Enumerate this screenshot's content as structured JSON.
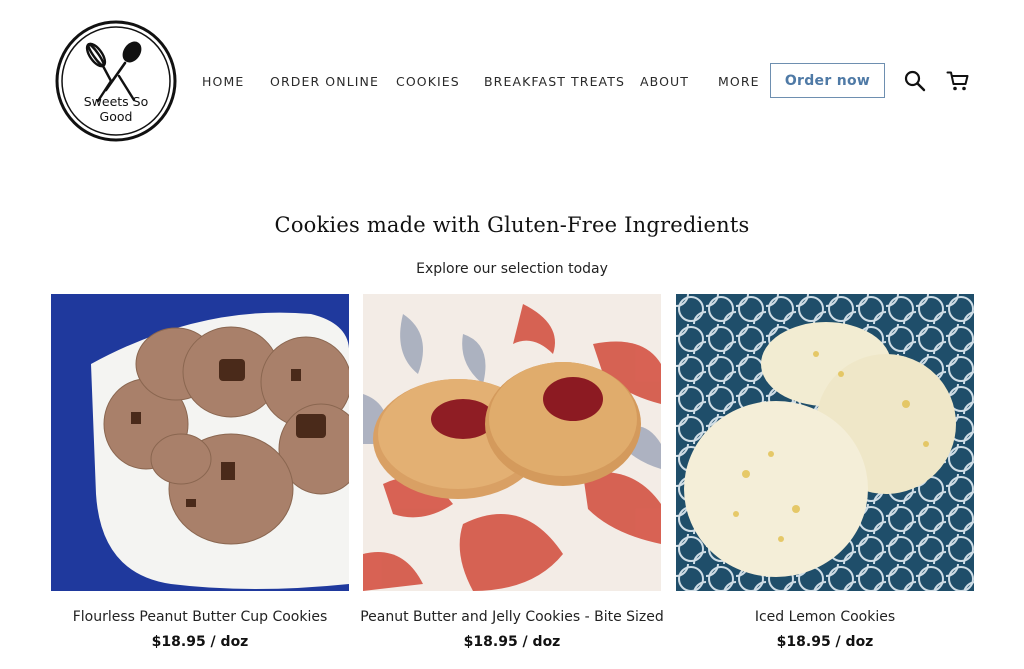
{
  "header": {
    "logo_text_line1": "Sweets So",
    "logo_text_line2": "Good",
    "nav": [
      "HOME",
      "ORDER ONLINE",
      "COOKIES",
      "BREAKFAST TREATS",
      "ABOUT",
      "MORE"
    ],
    "order_button_label": "Order now",
    "icons": [
      "search-icon",
      "cart-icon"
    ]
  },
  "main": {
    "title": "Cookies made with Gluten-Free Ingredients",
    "subtitle": "Explore our selection today",
    "products": [
      {
        "name": "Flourless Peanut Butter Cup Cookies",
        "price": "$18.95 / doz"
      },
      {
        "name": "Peanut Butter and Jelly Cookies - Bite Sized",
        "price": "$18.95 / doz"
      },
      {
        "name": "Iced Lemon Cookies",
        "price": "$18.95 / doz"
      }
    ]
  },
  "colors": {
    "accent": "#4f7aa6",
    "button_border": "#6e8fb0",
    "text": "#1a1a1a"
  }
}
